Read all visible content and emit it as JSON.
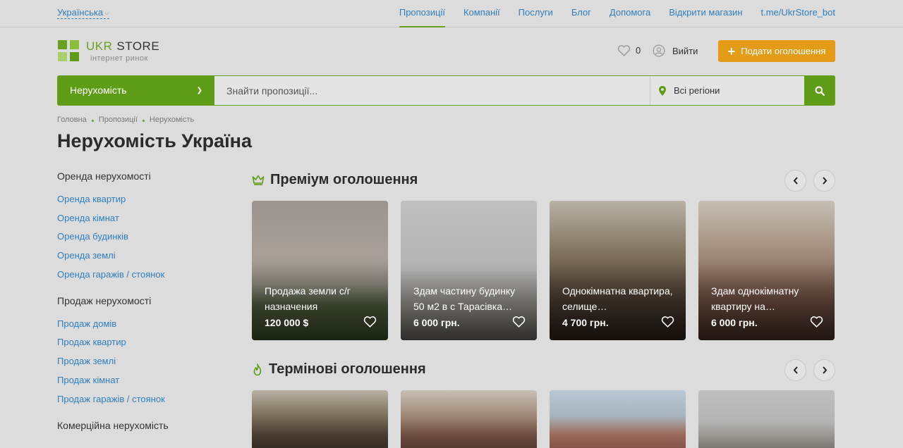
{
  "topbar": {
    "language": "Українська",
    "nav": [
      {
        "label": "Пропозиції",
        "active": true
      },
      {
        "label": "Компанії",
        "active": false
      },
      {
        "label": "Послуги",
        "active": false
      },
      {
        "label": "Блог",
        "active": false
      },
      {
        "label": "Допомога",
        "active": false
      },
      {
        "label": "Відкрити магазин",
        "active": false
      },
      {
        "label": "t.me/UkrStore_bot",
        "active": false
      }
    ]
  },
  "logo": {
    "ukr": "UKR",
    "store": "STORE",
    "subtitle": "інтернет ринок"
  },
  "header": {
    "favorites_count": "0",
    "login_label": "Вийти",
    "post_button_label": "Подати оголошення"
  },
  "search": {
    "category": "Нерухомість",
    "placeholder": "Знайти пропозиції...",
    "region": "Всі регіони"
  },
  "breadcrumb": [
    "Головна",
    "Пропозиції",
    "Нерухомість"
  ],
  "page_title": "Нерухомість Україна",
  "sidebar": [
    {
      "heading": "Оренда нерухомості",
      "links": [
        "Оренда квартир",
        "Оренда кімнат",
        "Оренда будинків",
        "Оренда землі",
        "Оренда гаражів / стоянок"
      ]
    },
    {
      "heading": "Продаж нерухомості",
      "links": [
        "Продаж домів",
        "Продаж квартир",
        "Продаж землі",
        "Продаж кімнат",
        "Продаж гаражів / стоянок"
      ]
    },
    {
      "heading": "Комерційна нерухомість",
      "links": []
    }
  ],
  "premium": {
    "title": "Преміум оголошення",
    "cards": [
      {
        "title": "Продажа земли с/г назначения",
        "price": "120 000 $"
      },
      {
        "title": "Здам частину будинку 50 м2 в с Тарасівка…",
        "price": "6 000 грн."
      },
      {
        "title": "Однокімнатна квартира, селище…",
        "price": "4 700 грн."
      },
      {
        "title": "Здам однокімнатну квартиру на…",
        "price": "6 000 грн."
      }
    ]
  },
  "urgent": {
    "title": "Термінові оголошення"
  },
  "colors": {
    "green": "#5f9c16",
    "orange": "#e49b16",
    "link": "#2f7fbd"
  }
}
